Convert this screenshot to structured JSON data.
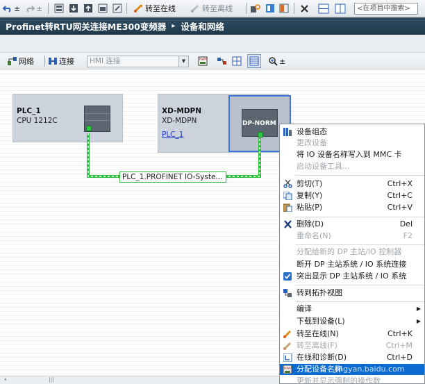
{
  "toolbar": {
    "go_online_label": "转至在线",
    "go_offline_label": "转至离线",
    "search_placeholder": "<在项目中搜索>"
  },
  "title": {
    "project": "Profinet转RTU网关连接ME300变频器",
    "section": "设备和网络",
    "arrow": "▸"
  },
  "network_toolbar": {
    "network_label": "网络",
    "connections_label": "连接",
    "hmi_select_value": "HMI 连接"
  },
  "devices": [
    {
      "name": "PLC_1",
      "type": "CPU 1212C"
    },
    {
      "name": "XD-MDPN",
      "type": "XD-MDPN",
      "link": "PLC_1",
      "module": "DP-NORM"
    }
  ],
  "network": {
    "label": "PLC_1.PROFINET IO-Syste..."
  },
  "context_menu": {
    "items": [
      {
        "label": "设备组态",
        "icon": "device-config-icon",
        "enabled": true
      },
      {
        "label": "更改设备",
        "enabled": false
      },
      {
        "label": "将 IO 设备名称写入到 MMC 卡",
        "enabled": true
      },
      {
        "label": "启动设备工具...",
        "enabled": false
      },
      {
        "label": "剪切(T)",
        "shortcut": "Ctrl+X",
        "icon": "cut-icon",
        "enabled": true
      },
      {
        "label": "复制(Y)",
        "shortcut": "Ctrl+C",
        "icon": "copy-icon",
        "enabled": true
      },
      {
        "label": "粘贴(P)",
        "shortcut": "Ctrl+V",
        "icon": "paste-icon",
        "enabled": true
      },
      {
        "label": "删除(D)",
        "shortcut": "Del",
        "icon": "delete-icon",
        "enabled": true
      },
      {
        "label": "重命名(N)",
        "shortcut": "F2",
        "enabled": false
      },
      {
        "label": "分配给新的 DP 主站/IO 控制器",
        "enabled": false
      },
      {
        "label": "断开 DP 主站系统 / IO 系统连接",
        "enabled": true
      },
      {
        "label": "突出显示 DP 主站系统 / IO 系统",
        "icon": "checkbox-checked-icon",
        "enabled": true
      },
      {
        "label": "转到拓扑视图",
        "icon": "topology-icon",
        "enabled": true
      },
      {
        "label": "编译",
        "submenu": true,
        "enabled": true
      },
      {
        "label": "下载到设备(L)",
        "submenu": true,
        "enabled": true
      },
      {
        "label": "转至在线(N)",
        "shortcut": "Ctrl+K",
        "icon": "go-online-icon",
        "enabled": true
      },
      {
        "label": "转至离线(F)",
        "shortcut": "Ctrl+M",
        "icon": "go-offline-icon",
        "enabled": false
      },
      {
        "label": "在线和诊断(D)",
        "shortcut": "Ctrl+D",
        "icon": "diagnostics-icon",
        "enabled": true
      },
      {
        "label": "分配设备名称",
        "icon": "assign-name-icon",
        "enabled": true,
        "highlighted": true
      },
      {
        "label": "更新并显示强制的操作数",
        "enabled": false
      }
    ],
    "watermark": "jingyan.baidu.com"
  },
  "colors": {
    "title_bar": "#2a4459",
    "device_fill": "#cdd3dd",
    "selection": "#2f6fd0",
    "network_line": "#2bbf3f",
    "menu_highlight": "#0b6bd0"
  }
}
